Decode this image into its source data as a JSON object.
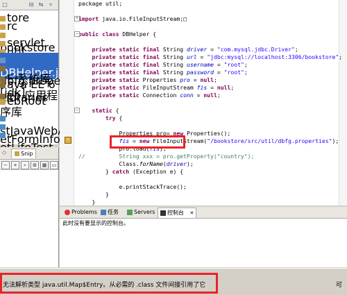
{
  "explorer": {
    "items": [
      {
        "label": "tore",
        "icon": "package-icon"
      },
      {
        "label": "rc",
        "icon": "folder-icon"
      },
      {
        "label": "bookstore",
        "icon": "package-icon"
      },
      {
        "label": "servlet",
        "icon": "package-icon"
      },
      {
        "label": "util",
        "icon": "package-icon"
      },
      {
        "label": "DBHelper.java",
        "icon": "java-file-icon"
      },
      {
        "label": "dbfg.properti",
        "icon": "properties-file-icon"
      },
      {
        "label": "E 系统库 [jdk]",
        "icon": "library-icon"
      },
      {
        "label": "ava EE 6 Libraries",
        "icon": "library-icon"
      },
      {
        "label": "eb 应用程序库",
        "icon": "library-icon"
      },
      {
        "label": "ebRoot",
        "icon": "folder-icon"
      },
      {
        "label": "",
        "icon": ""
      },
      {
        "label": "stJavaWebApp",
        "icon": "project-icon"
      },
      {
        "label": "etFormInfo",
        "icon": "project-icon"
      },
      {
        "label": "etLifeTest",
        "icon": "project-icon"
      }
    ]
  },
  "snippets": {
    "tab_label": "Snip"
  },
  "editor": {
    "lines": [
      {
        "segments": [
          {
            "t": "package util;",
            "c": ""
          }
        ]
      },
      {
        "segments": []
      },
      {
        "segments": [
          {
            "t": "import",
            "c": "kw"
          },
          {
            "t": " java.io.FileInputStream;",
            "c": ""
          },
          {
            "t": "□",
            "c": ""
          }
        ]
      },
      {
        "segments": []
      },
      {
        "segments": [
          {
            "t": "public",
            "c": "kw"
          },
          {
            "t": " ",
            "c": ""
          },
          {
            "t": "class",
            "c": "kw"
          },
          {
            "t": " DBHelper {",
            "c": ""
          }
        ]
      },
      {
        "segments": []
      },
      {
        "segments": [
          {
            "t": "    private",
            "c": "kw"
          },
          {
            "t": " ",
            "c": ""
          },
          {
            "t": "static",
            "c": "kw"
          },
          {
            "t": " ",
            "c": ""
          },
          {
            "t": "final",
            "c": "kw"
          },
          {
            "t": " String ",
            "c": ""
          },
          {
            "t": "driver",
            "c": "fld"
          },
          {
            "t": " = ",
            "c": ""
          },
          {
            "t": "\"com.mysql.jdbc.Driver\"",
            "c": "str"
          },
          {
            "t": ";",
            "c": ""
          }
        ]
      },
      {
        "segments": [
          {
            "t": "    private",
            "c": "kw"
          },
          {
            "t": " ",
            "c": ""
          },
          {
            "t": "static",
            "c": "kw"
          },
          {
            "t": " ",
            "c": ""
          },
          {
            "t": "final",
            "c": "kw"
          },
          {
            "t": " String ",
            "c": ""
          },
          {
            "t": "url",
            "c": "fld"
          },
          {
            "t": " = ",
            "c": ""
          },
          {
            "t": "\"jdbc:mysql://localhost:3306/bookstore\"",
            "c": "str"
          },
          {
            "t": ";",
            "c": ""
          }
        ]
      },
      {
        "segments": [
          {
            "t": "    private",
            "c": "kw"
          },
          {
            "t": " ",
            "c": ""
          },
          {
            "t": "static",
            "c": "kw"
          },
          {
            "t": " ",
            "c": ""
          },
          {
            "t": "final",
            "c": "kw"
          },
          {
            "t": " String ",
            "c": ""
          },
          {
            "t": "username",
            "c": "fld"
          },
          {
            "t": " = ",
            "c": ""
          },
          {
            "t": "\"root\"",
            "c": "str"
          },
          {
            "t": ";",
            "c": ""
          }
        ]
      },
      {
        "segments": [
          {
            "t": "    private",
            "c": "kw"
          },
          {
            "t": " ",
            "c": ""
          },
          {
            "t": "static",
            "c": "kw"
          },
          {
            "t": " ",
            "c": ""
          },
          {
            "t": "final",
            "c": "kw"
          },
          {
            "t": " String ",
            "c": ""
          },
          {
            "t": "password",
            "c": "fld"
          },
          {
            "t": " = ",
            "c": ""
          },
          {
            "t": "\"root\"",
            "c": "str"
          },
          {
            "t": ";",
            "c": ""
          }
        ]
      },
      {
        "segments": [
          {
            "t": "    private",
            "c": "kw"
          },
          {
            "t": " ",
            "c": ""
          },
          {
            "t": "static",
            "c": "kw"
          },
          {
            "t": " Properties ",
            "c": ""
          },
          {
            "t": "pro",
            "c": "fld"
          },
          {
            "t": " = ",
            "c": ""
          },
          {
            "t": "null",
            "c": "kw"
          },
          {
            "t": ";",
            "c": ""
          }
        ]
      },
      {
        "segments": [
          {
            "t": "    private",
            "c": "kw"
          },
          {
            "t": " ",
            "c": ""
          },
          {
            "t": "static",
            "c": "kw"
          },
          {
            "t": " FileInputStream ",
            "c": ""
          },
          {
            "t": "fis",
            "c": "fld"
          },
          {
            "t": " = ",
            "c": ""
          },
          {
            "t": "null",
            "c": "kw"
          },
          {
            "t": ";",
            "c": ""
          }
        ]
      },
      {
        "segments": [
          {
            "t": "    private",
            "c": "kw"
          },
          {
            "t": " ",
            "c": ""
          },
          {
            "t": "static",
            "c": "kw"
          },
          {
            "t": " Connection ",
            "c": ""
          },
          {
            "t": "conn",
            "c": "fld"
          },
          {
            "t": " = ",
            "c": ""
          },
          {
            "t": "null",
            "c": "kw"
          },
          {
            "t": ";",
            "c": ""
          }
        ]
      },
      {
        "segments": []
      },
      {
        "segments": [
          {
            "t": "    static",
            "c": "kw"
          },
          {
            "t": " {",
            "c": ""
          }
        ]
      },
      {
        "segments": [
          {
            "t": "        try",
            "c": "kw"
          },
          {
            "t": " {",
            "c": ""
          }
        ]
      },
      {
        "segments": []
      },
      {
        "segments": [
          {
            "t": "            Properties pro= ",
            "c": ""
          },
          {
            "t": "new",
            "c": "kw"
          },
          {
            "t": " Properties();",
            "c": ""
          }
        ]
      },
      {
        "segments": [
          {
            "t": "            ",
            "c": ""
          },
          {
            "t": "fis",
            "c": "fld"
          },
          {
            "t": " = ",
            "c": ""
          },
          {
            "t": "new",
            "c": "kw"
          },
          {
            "t": " FileInputStream(",
            "c": ""
          },
          {
            "t": "\"/bookstore/src/util/dbfg.properties\"",
            "c": "str"
          },
          {
            "t": ");",
            "c": ""
          }
        ]
      },
      {
        "segments": [
          {
            "t": "            pro.load(",
            "c": ""
          },
          {
            "t": "fis",
            "c": "fld"
          },
          {
            "t": ");",
            "c": ""
          }
        ]
      },
      {
        "segments": [
          {
            "t": "//          String xxx = pro.getProperty(\"country\");",
            "c": "cmt"
          }
        ]
      },
      {
        "segments": [
          {
            "t": "            Class.",
            "c": ""
          },
          {
            "t": "forName",
            "c": "it"
          },
          {
            "t": "(",
            "c": ""
          },
          {
            "t": "driver",
            "c": "fld"
          },
          {
            "t": ");",
            "c": ""
          }
        ]
      },
      {
        "segments": [
          {
            "t": "        } ",
            "c": ""
          },
          {
            "t": "catch",
            "c": "kw"
          },
          {
            "t": " (Exception e) {",
            "c": ""
          }
        ]
      },
      {
        "segments": []
      },
      {
        "segments": [
          {
            "t": "            e.printStackTrace();",
            "c": ""
          }
        ]
      },
      {
        "segments": [
          {
            "t": "        }",
            "c": ""
          }
        ]
      },
      {
        "segments": [
          {
            "t": "    }",
            "c": ""
          }
        ]
      },
      {
        "segments": []
      }
    ]
  },
  "console": {
    "tabs": [
      {
        "label": "Problems",
        "icon": "problems-icon"
      },
      {
        "label": "任务",
        "icon": "tasks-icon"
      },
      {
        "label": "Servers",
        "icon": "servers-icon"
      },
      {
        "label": "控制台",
        "icon": "console-icon"
      }
    ],
    "close_glyph": "✕",
    "message": "此时没有要显示的控制台。"
  },
  "status": {
    "message": "无法解析类型 java.util.Map$Entry。从必需的 .class 文件间接引用了它",
    "right": "可"
  },
  "colors": {
    "annotation_red": "#e8232a",
    "keyword": "#7f0055",
    "string": "#2a00ff",
    "field": "#0000c0"
  }
}
